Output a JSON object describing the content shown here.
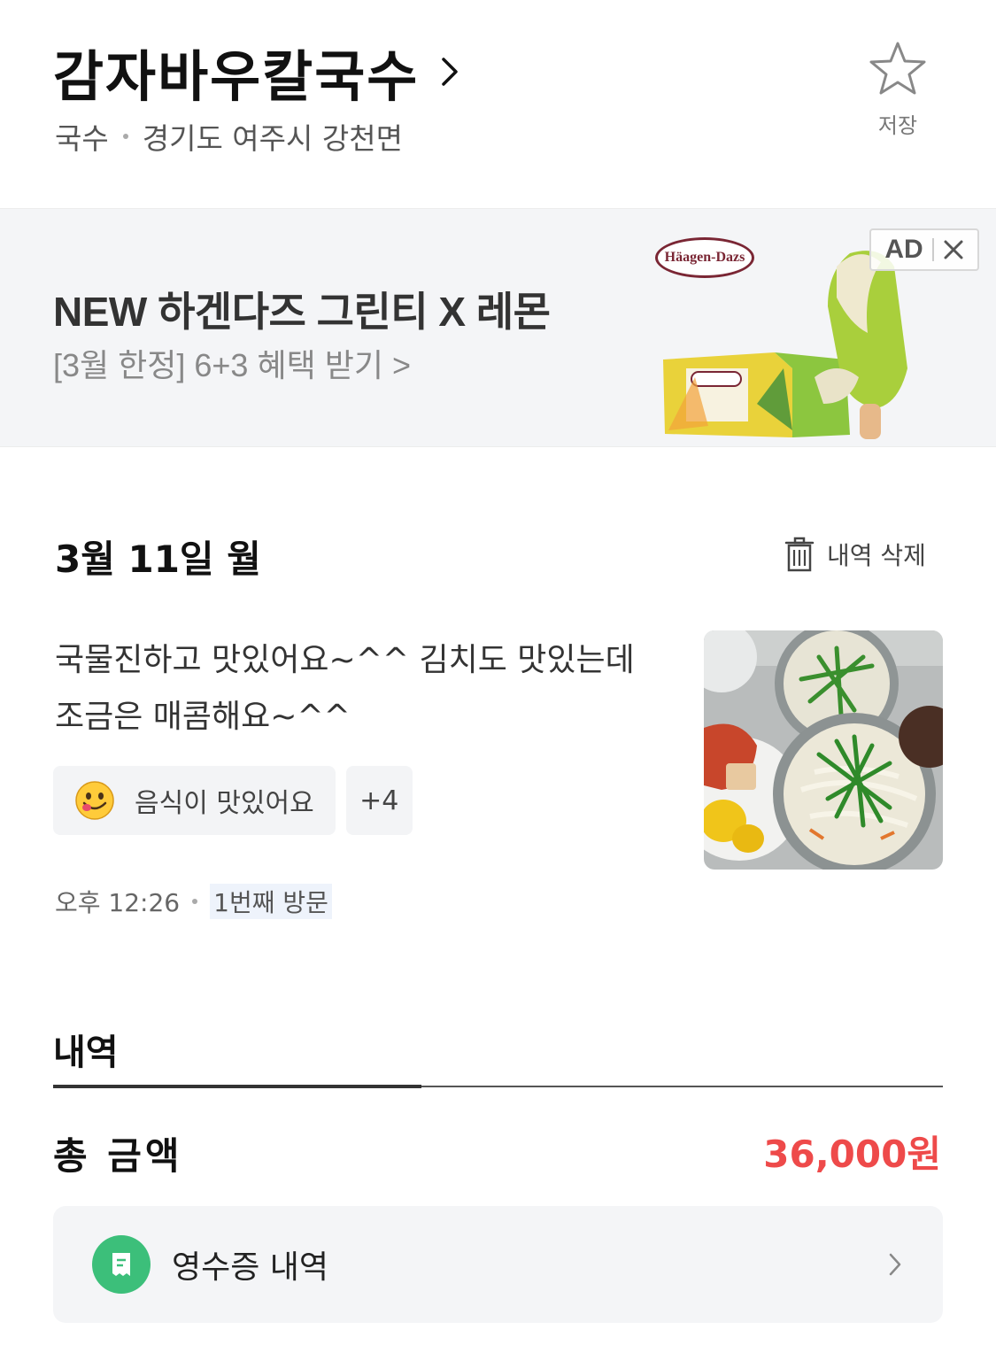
{
  "header": {
    "restaurant_name": "감자바우칼국수",
    "category": "국수",
    "address": "경기도 여주시 강천면",
    "save_label": "저장"
  },
  "ad": {
    "title": "NEW 하겐다즈 그린티 X 레몬",
    "subtitle": "[3월 한정] 6+3 혜택 받기 >",
    "brand": "Häagen-Dazs",
    "badge": "AD"
  },
  "visit": {
    "date": "3월 11일 월",
    "delete_label": "내역 삭제",
    "review_text": "국물진하고 맛있어요~^^ 김치도 맛있는데 조금은 매콤해요~^^",
    "tags": [
      {
        "label": "음식이 맛있어요",
        "icon": "smiley-tongue-icon"
      },
      {
        "label": "+4"
      }
    ],
    "time": "오후 12:26",
    "visit_count": "1번째 방문"
  },
  "detail": {
    "title": "내역",
    "total_label": "총 금액",
    "total_amount": "36,000원",
    "receipt_label": "영수증 내역"
  },
  "colors": {
    "accent_red": "#ee4a4a",
    "receipt_green": "#3cbf7a",
    "ad_bg": "#f4f5f7"
  }
}
